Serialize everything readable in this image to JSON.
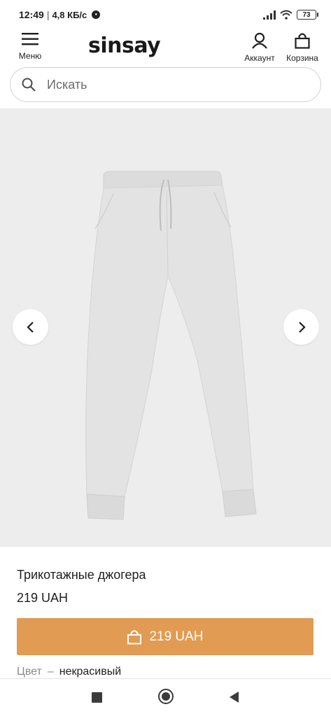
{
  "status_bar": {
    "time": "12:49",
    "separator": "|",
    "speed": "4,8 КБ/с",
    "battery": "73"
  },
  "header": {
    "menu_label": "Меню",
    "logo": "sinsay",
    "account_label": "Аккаунт",
    "cart_label": "Корзина"
  },
  "search": {
    "placeholder": "Искать"
  },
  "product": {
    "name": "Трикотажные джогера",
    "price": "219 UAH",
    "buy_label": "219 UAH",
    "color_label": "Цвет",
    "color_dash": "–",
    "color_value": "некрасивый"
  },
  "colors": {
    "accent": "#e19b53",
    "gallery_bg": "#ededed",
    "text": "#1f1f1f"
  },
  "icons": {
    "menu": "hamburger-icon",
    "account": "user-icon",
    "cart": "shopping-bag-icon",
    "search": "search-icon",
    "prev": "chevron-left-icon",
    "next": "chevron-right-icon"
  }
}
